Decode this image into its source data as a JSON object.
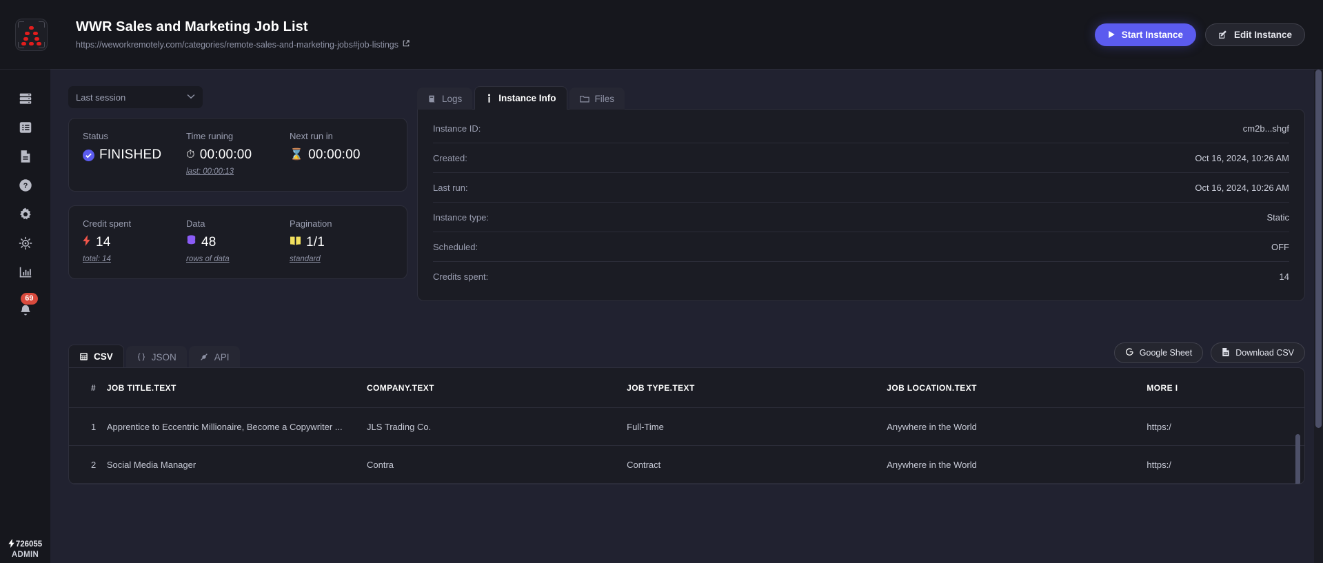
{
  "header": {
    "title": "WWR Sales and Marketing Job List",
    "url": "https://weworkremotely.com/categories/remote-sales-and-marketing-jobs#job-listings",
    "external_link_icon": "external-link-icon",
    "start_button": {
      "label": "Start Instance",
      "icon": "play-icon"
    },
    "edit_button": {
      "label": "Edit Instance",
      "icon": "pencil-square-icon"
    },
    "accent": "#5b5bef"
  },
  "sidebar": {
    "items": [
      {
        "name": "servers-icon",
        "label": "Servers"
      },
      {
        "name": "list-icon",
        "label": "Lists"
      },
      {
        "name": "document-icon",
        "label": "Documents"
      },
      {
        "name": "help-circle-icon",
        "label": "Help"
      },
      {
        "name": "gear-icon",
        "label": "Settings"
      },
      {
        "name": "target-icon",
        "label": "Targets"
      },
      {
        "name": "bar-chart-icon",
        "label": "Analytics"
      },
      {
        "name": "bell-icon",
        "label": "Notifications",
        "badge": "69"
      }
    ],
    "footer": {
      "credits": "726055",
      "credits_icon": "bolt-icon",
      "role": "ADMIN"
    }
  },
  "session_select": {
    "value": "Last session",
    "icon": "chevron-down-icon"
  },
  "status_card": {
    "status": {
      "label": "Status",
      "value": "FINISHED",
      "icon": "check-circle-icon",
      "color": "#5b5bef"
    },
    "time_running": {
      "label": "Time runing",
      "value": "00:00:00",
      "icon": "stopwatch-icon",
      "sub": "last: 00:00:13"
    },
    "next_run": {
      "label": "Next run in",
      "value": "00:00:00",
      "icon": "hourglass-icon"
    }
  },
  "metrics_card": {
    "credit": {
      "label": "Credit spent",
      "value": "14",
      "icon": "bolt-icon",
      "sub": "total: 14",
      "color": "#f0554a"
    },
    "data": {
      "label": "Data",
      "value": "48",
      "icon": "database-icon",
      "sub": "rows of data",
      "color": "#8b5cf6"
    },
    "pagination": {
      "label": "Pagination",
      "value": "1/1",
      "icon": "book-icon",
      "sub": "standard",
      "color": "#f2e05e"
    }
  },
  "info_tabs": [
    {
      "label": "Logs",
      "icon": "scroll-icon",
      "active": false
    },
    {
      "label": "Instance Info",
      "icon": "info-icon",
      "active": true
    },
    {
      "label": "Files",
      "icon": "folder-icon",
      "active": false
    }
  ],
  "instance_info": [
    {
      "key": "Instance ID:",
      "value": "cm2b...shgf"
    },
    {
      "key": "Created:",
      "value": "Oct 16, 2024, 10:26 AM"
    },
    {
      "key": "Last run:",
      "value": "Oct 16, 2024, 10:26 AM"
    },
    {
      "key": "Instance type:",
      "value": "Static"
    },
    {
      "key": "Scheduled:",
      "value": "OFF"
    },
    {
      "key": "Credits spent:",
      "value": "14"
    }
  ],
  "data_tabs": [
    {
      "label": "CSV",
      "icon": "table-icon",
      "active": true
    },
    {
      "label": "JSON",
      "icon": "braces-icon",
      "active": false
    },
    {
      "label": "API",
      "icon": "plug-icon",
      "active": false
    }
  ],
  "data_buttons": {
    "google_sheet": {
      "label": "Google Sheet",
      "icon": "google-icon"
    },
    "download_csv": {
      "label": "Download CSV",
      "icon": "file-csv-icon"
    }
  },
  "table": {
    "columns": [
      "#",
      "JOB TITLE.TEXT",
      "COMPANY.TEXT",
      "JOB TYPE.TEXT",
      "JOB LOCATION.TEXT",
      "MORE I"
    ],
    "rows": [
      {
        "idx": "1",
        "job_title": "Apprentice to Eccentric Millionaire, Become a Copywriter ...",
        "company": "JLS Trading Co.",
        "job_type": "Full-Time",
        "job_location": "Anywhere in the World",
        "more": "https:/"
      },
      {
        "idx": "2",
        "job_title": "Social Media Manager",
        "company": "Contra",
        "job_type": "Contract",
        "job_location": "Anywhere in the World",
        "more": "https:/"
      }
    ]
  }
}
